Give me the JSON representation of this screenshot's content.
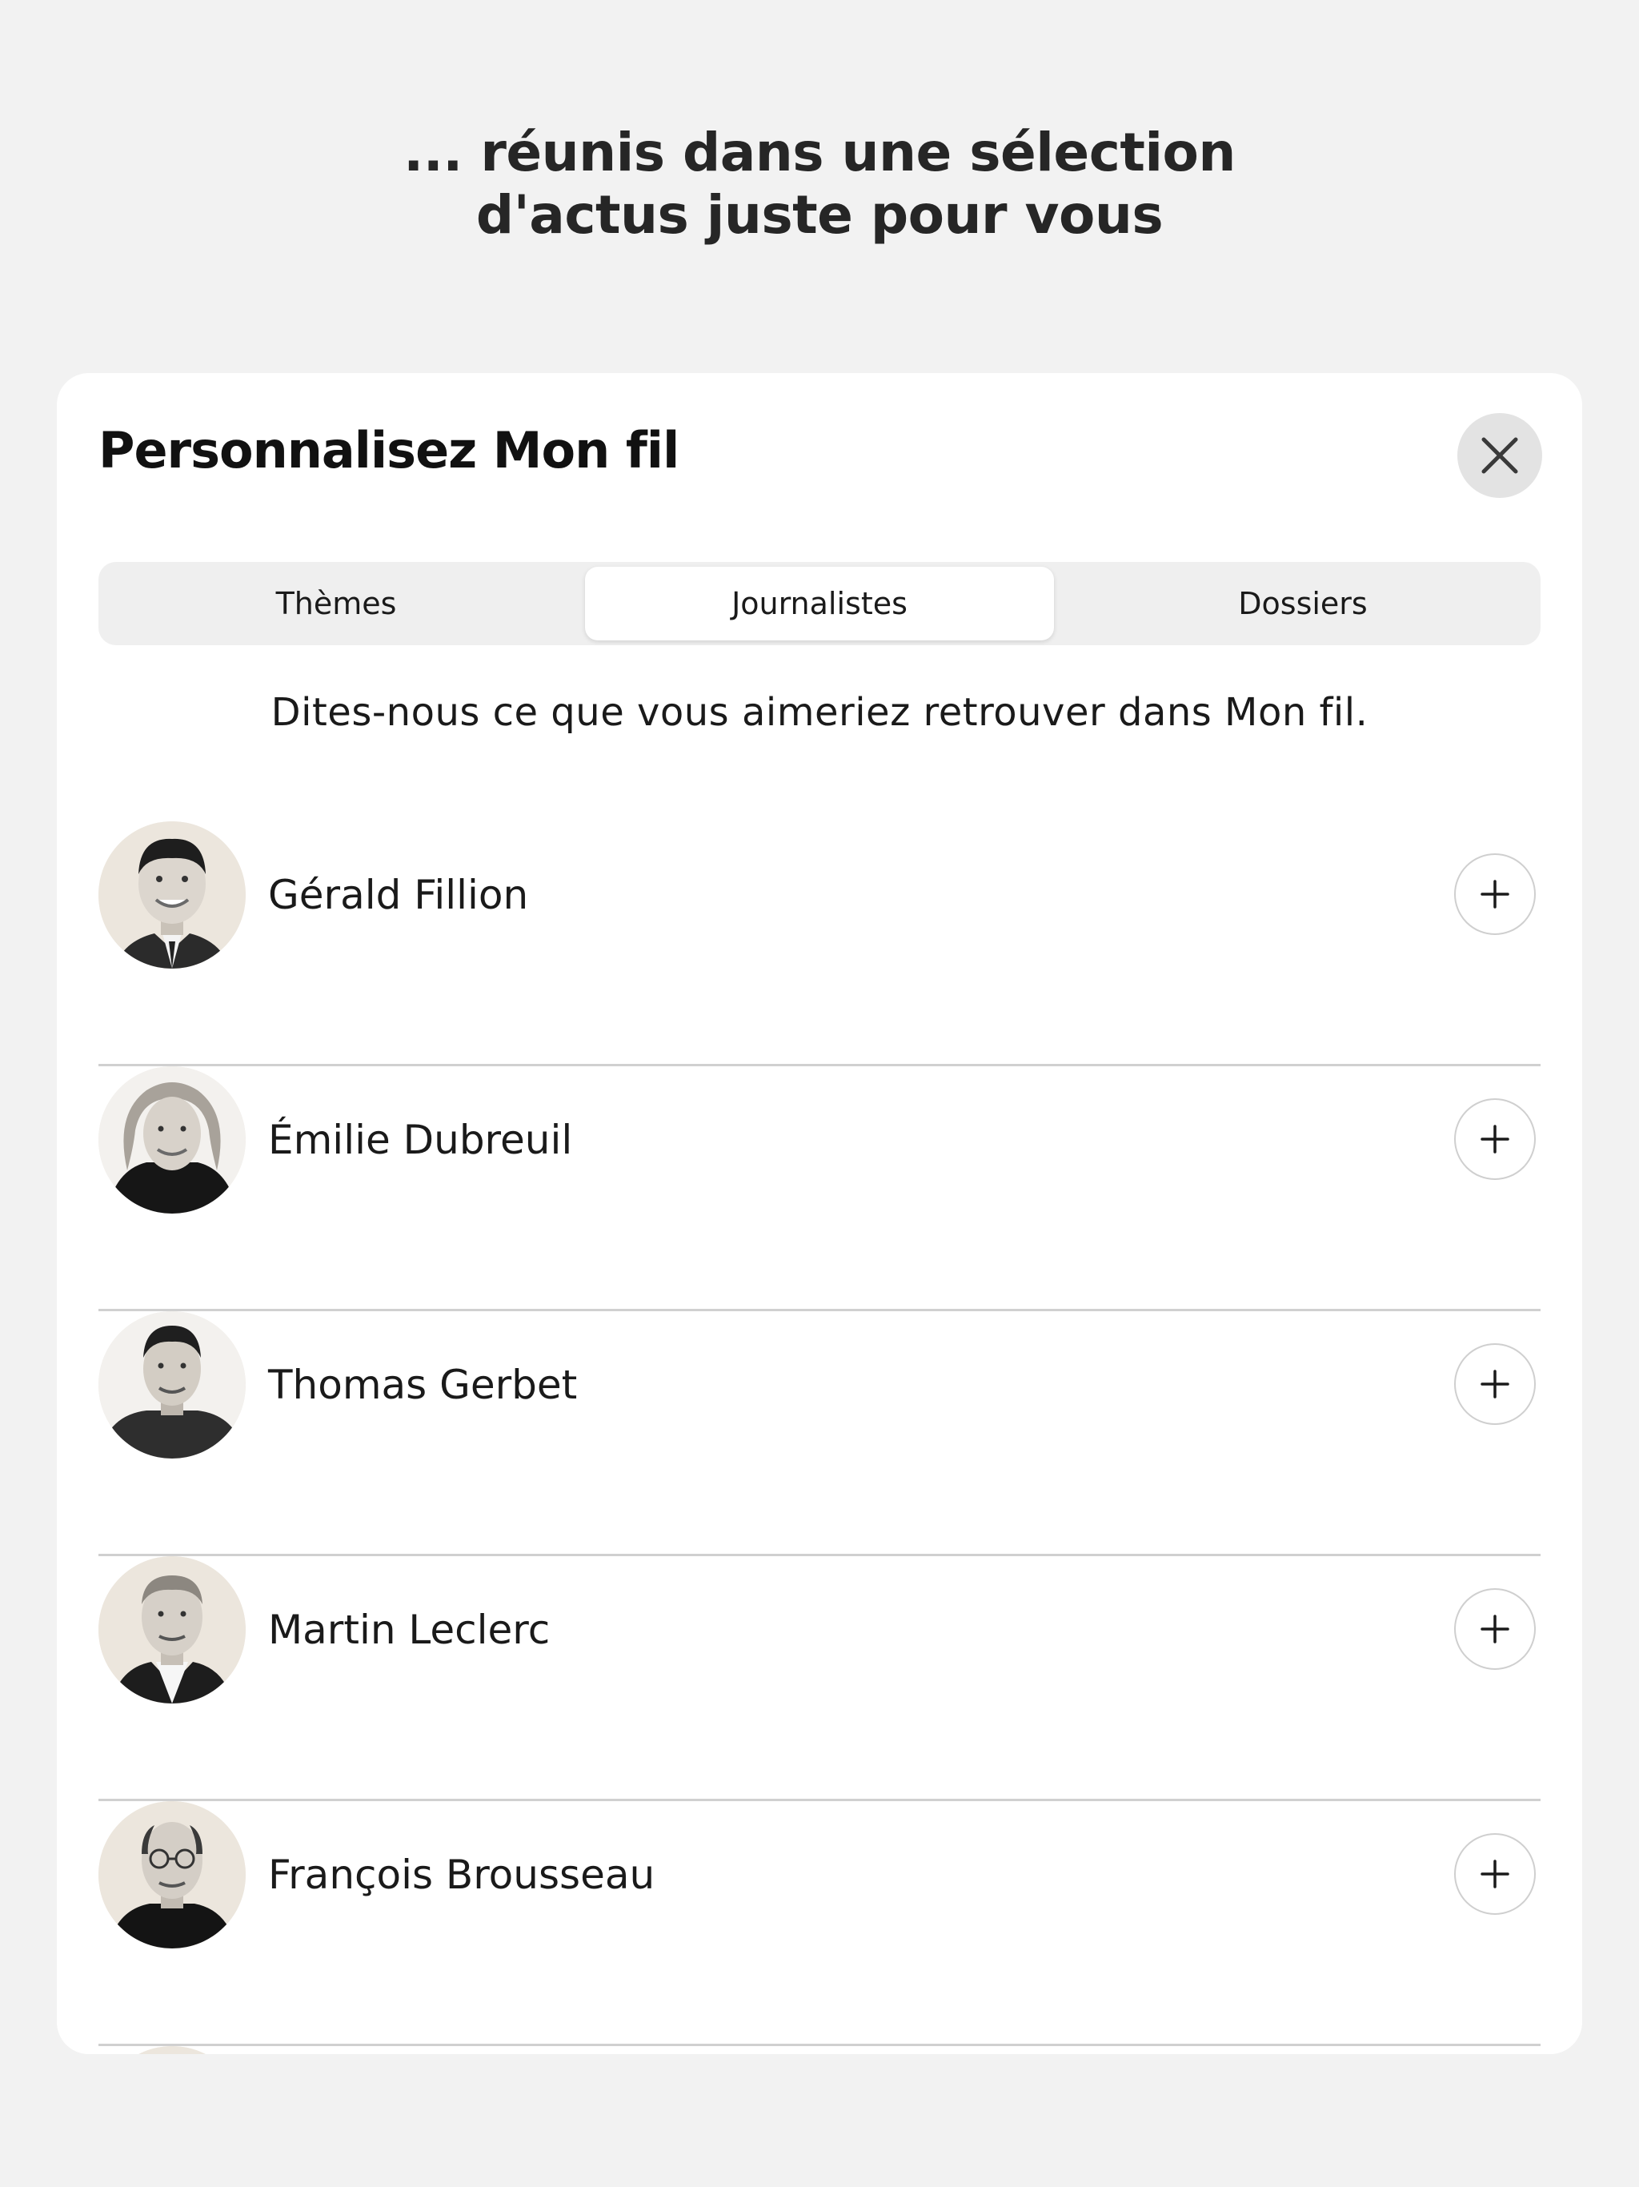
{
  "headline": {
    "line1": "... réunis dans une sélection",
    "line2": "d'actus juste pour vous"
  },
  "sheet": {
    "title": "Personnalisez Mon fil",
    "close_icon": "close-icon",
    "tabs": [
      {
        "label": "Thèmes",
        "selected": false
      },
      {
        "label": "Journalistes",
        "selected": true
      },
      {
        "label": "Dossiers",
        "selected": false
      }
    ],
    "subtitle": "Dites-nous ce que vous aimeriez retrouver dans Mon fil.",
    "journalists": [
      {
        "name": "Gérald Fillion",
        "action_icon": "plus-icon"
      },
      {
        "name": "Émilie Dubreuil",
        "action_icon": "plus-icon"
      },
      {
        "name": "Thomas Gerbet",
        "action_icon": "plus-icon"
      },
      {
        "name": "Martin Leclerc",
        "action_icon": "plus-icon"
      },
      {
        "name": "François Brousseau",
        "action_icon": "plus-icon"
      }
    ]
  },
  "colors": {
    "background": "#f2f2f2",
    "sheet": "#ffffff",
    "segment_track": "#efefef",
    "close_button": "#e3e3e3",
    "avatar_bg": "#ece6dd",
    "divider": "#d0d0d0"
  }
}
